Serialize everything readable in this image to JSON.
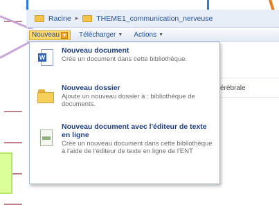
{
  "breadcrumb": {
    "root_label": "Racine",
    "separator": "▸",
    "folder_label": "THEME1_communication_nerveuse"
  },
  "toolbar": {
    "new_label": "Nouveau",
    "download_label": "Télécharger",
    "actions_label": "Actions"
  },
  "background": {
    "partial_text": "érébrale"
  },
  "menu": {
    "items": [
      {
        "icon": "word-document-icon",
        "title": "Nouveau document",
        "description": "Crée un document dans cette bibliothèque."
      },
      {
        "icon": "folder-icon",
        "title": "Nouveau dossier",
        "description": "Ajoute un nouveau dossier à : bibliothèque de documents."
      },
      {
        "icon": "online-editor-icon",
        "title": "Nouveau document avec l'éditeur de texte en ligne",
        "description": "Crée un nouveau document dans cette bibliothèque à l'aide de l'éditeur de texte en ligne de l'ENT"
      }
    ]
  },
  "colors": {
    "accent_blue": "#1f4e99",
    "menu_title": "#1f3e83",
    "highlight_orange": "#f3a62c",
    "annotation_blue": "#2a78e0",
    "annotation_green": "#ddff99"
  }
}
